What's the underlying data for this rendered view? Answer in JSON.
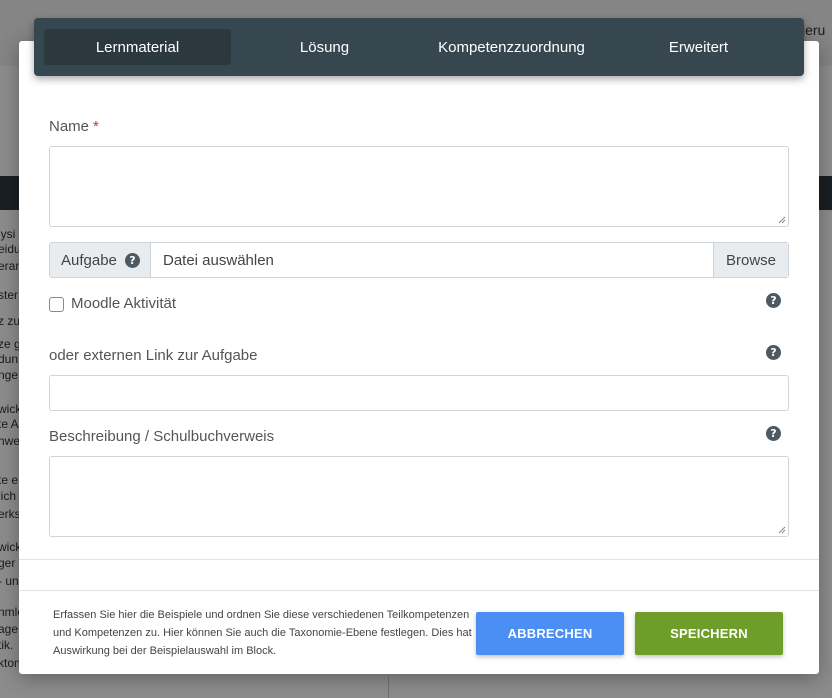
{
  "background": {
    "right_text": "sieru",
    "left_lines": [
      "lysi",
      "eidu",
      "eran",
      "ster",
      "z zu",
      "ze g",
      "dun",
      "nge",
      "wick",
      "te A",
      "nwe",
      "te e",
      "lich",
      "erksi",
      "wick",
      "ger",
      "- un",
      "nmle",
      "age",
      "tik.",
      "kton"
    ]
  },
  "tabs": [
    {
      "label": "Lernmaterial",
      "active": true
    },
    {
      "label": "Lösung",
      "active": false
    },
    {
      "label": "Kompetenzzuordnung",
      "active": false
    },
    {
      "label": "Erweitert",
      "active": false
    }
  ],
  "form": {
    "name_label": "Name",
    "required_mark": "*",
    "name_value": "",
    "file_prefix": "Aufgabe",
    "file_placeholder": "Datei auswählen",
    "browse_label": "Browse",
    "moodle_label": "Moodle Aktivität",
    "moodle_checked": false,
    "link_label": "oder externen Link zur Aufgabe",
    "link_value": "",
    "desc_label": "Beschreibung / Schulbuchverweis",
    "desc_value": "",
    "help_icon_glyph": "?"
  },
  "footer": {
    "info_text": "Erfassen Sie hier die Beispiele und ordnen Sie diese verschiedenen Teilkompetenzen und Kompetenzen zu. Hier können Sie auch die Taxonomie-Ebene festlegen. Dies hat Auswirkung bei der Beispielauswahl im Block.",
    "cancel_label": "ABBRECHEN",
    "save_label": "SPEICHERN"
  },
  "colors": {
    "tabbar": "#37474f",
    "tab_active": "#2b383e",
    "cancel_button": "#4b8ff5",
    "save_button": "#6e9d2a",
    "required": "#c0392b"
  },
  "icons": {
    "help": "question-circle-icon",
    "resize": "resize-handle-icon"
  }
}
